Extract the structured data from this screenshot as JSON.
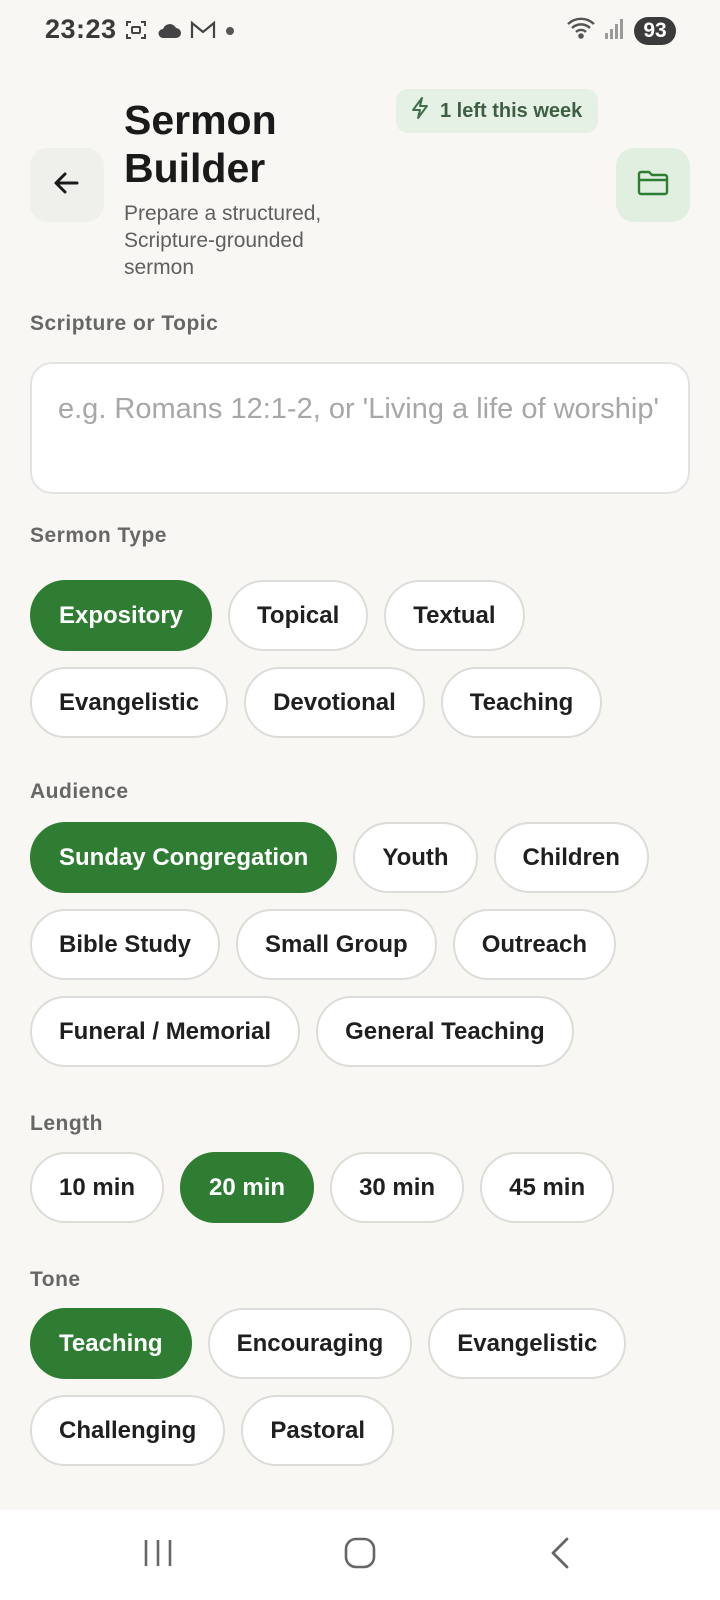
{
  "status": {
    "time": "23:23",
    "battery": "93",
    "icons_left": [
      "screenshot-icon",
      "cloud-icon",
      "gmail-icon",
      "dot-icon"
    ],
    "icons_right": [
      "wifi-icon",
      "signal-icon"
    ]
  },
  "header": {
    "title_line1": "Sermon",
    "title_line2": "Builder",
    "subtitle": "Prepare a structured, Scripture-grounded sermon",
    "usage": "1 left this week"
  },
  "scripture": {
    "label": "Scripture or Topic",
    "placeholder": "e.g. Romans 12:1-2, or 'Living a life of worship'",
    "value": ""
  },
  "sermon_type": {
    "label": "Sermon Type",
    "options": [
      "Expository",
      "Topical",
      "Textual",
      "Evangelistic",
      "Devotional",
      "Teaching"
    ],
    "selected": "Expository"
  },
  "audience": {
    "label": "Audience",
    "options": [
      "Sunday Congregation",
      "Youth",
      "Children",
      "Bible Study",
      "Small Group",
      "Outreach",
      "Funeral / Memorial",
      "General Teaching"
    ],
    "selected": "Sunday Congregation"
  },
  "length": {
    "label": "Length",
    "options": [
      "10 min",
      "20 min",
      "30 min",
      "45 min"
    ],
    "selected": "20 min"
  },
  "tone": {
    "label": "Tone",
    "options": [
      "Teaching",
      "Encouraging",
      "Evangelistic",
      "Challenging",
      "Pastoral"
    ],
    "selected": "Teaching"
  },
  "colors": {
    "accent": "#2e7d32",
    "background": "#f8f7f4",
    "pill_bg": "#e4f1e4"
  }
}
